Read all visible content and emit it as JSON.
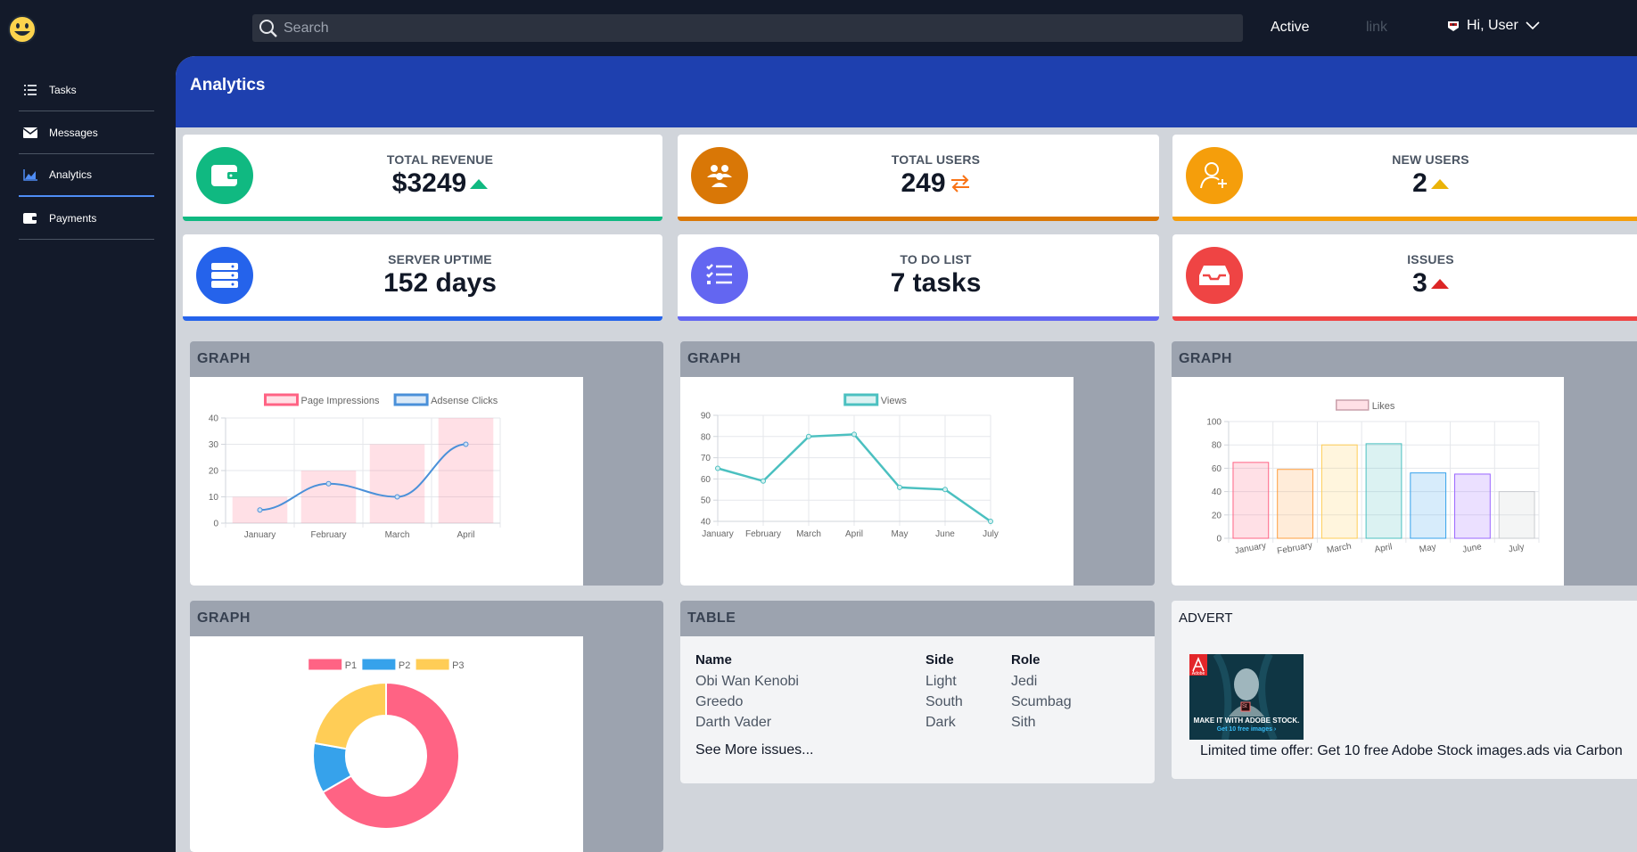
{
  "sidebar": {
    "items": [
      {
        "label": "Tasks",
        "icon": "tasks-list-icon"
      },
      {
        "label": "Messages",
        "icon": "envelope-icon"
      },
      {
        "label": "Analytics",
        "icon": "area-chart-icon"
      },
      {
        "label": "Payments",
        "icon": "wallet-icon"
      }
    ]
  },
  "topbar": {
    "search_placeholder": "Search",
    "active_label": "Active",
    "link_label": "link",
    "user_label": "Hi, User"
  },
  "header": {
    "title": "Analytics"
  },
  "stats": [
    {
      "label": "TOTAL REVENUE",
      "value": "$3249",
      "icon": "wallet-icon",
      "color": "#10b981",
      "trend": "up"
    },
    {
      "label": "TOTAL USERS",
      "value": "249",
      "icon": "users-icon",
      "color": "#d97706",
      "trend": "exchange"
    },
    {
      "label": "NEW USERS",
      "value": "2",
      "icon": "user-plus-icon",
      "color": "#f59e0b",
      "trend": "up"
    },
    {
      "label": "SERVER UPTIME",
      "value": "152 days",
      "icon": "server-icon",
      "color": "#2563eb",
      "trend": "none"
    },
    {
      "label": "TO DO LIST",
      "value": "7 tasks",
      "icon": "tasks-icon",
      "color": "#6366f1",
      "trend": "none"
    },
    {
      "label": "ISSUES",
      "value": "3",
      "icon": "inbox-icon",
      "color": "#ef4444",
      "trend": "up"
    }
  ],
  "panels": {
    "graph1_title": "GRAPH",
    "graph2_title": "GRAPH",
    "graph3_title": "GRAPH",
    "graph4_title": "GRAPH",
    "table_title": "TABLE",
    "advert_title": "ADVERT"
  },
  "table": {
    "headers": [
      "Name",
      "Side",
      "Role"
    ],
    "rows": [
      [
        "Obi Wan Kenobi",
        "Light",
        "Jedi"
      ],
      [
        "Greedo",
        "South",
        "Scumbag"
      ],
      [
        "Darth Vader",
        "Dark",
        "Sith"
      ]
    ],
    "more_label": "See More issues..."
  },
  "advert": {
    "text": "Limited time offer: Get 10 free Adobe Stock images.ads via Carbon",
    "image_caption": "MAKE IT WITH ADOBE STOCK.",
    "image_sub": "Get 10 free images ›",
    "brand": "Adobe",
    "badge": "St"
  },
  "chart_data": [
    {
      "type": "bar",
      "categories": [
        "January",
        "February",
        "March",
        "April"
      ],
      "series": [
        {
          "name": "Page Impressions",
          "type": "bar",
          "values": [
            10,
            20,
            30,
            40
          ],
          "color": "#ff6384"
        },
        {
          "name": "Adsense Clicks",
          "type": "line",
          "values": [
            5,
            15,
            10,
            30
          ],
          "color": "#4a90d9"
        }
      ],
      "ylim": [
        0,
        40
      ],
      "yticks": [
        0,
        10,
        20,
        30,
        40
      ],
      "legend": "top"
    },
    {
      "type": "line",
      "categories": [
        "January",
        "February",
        "March",
        "April",
        "May",
        "June",
        "July"
      ],
      "series": [
        {
          "name": "Views",
          "values": [
            65,
            59,
            80,
            81,
            56,
            55,
            40
          ],
          "color": "#4bc0c0"
        }
      ],
      "ylim": [
        40,
        90
      ],
      "yticks": [
        40,
        50,
        60,
        70,
        80,
        90
      ],
      "legend": "top"
    },
    {
      "type": "bar",
      "categories": [
        "January",
        "February",
        "March",
        "April",
        "May",
        "June",
        "July"
      ],
      "series": [
        {
          "name": "Likes",
          "values": [
            65,
            59,
            80,
            81,
            56,
            55,
            40
          ],
          "colors": [
            "#ff6384",
            "#ff9f40",
            "#ffcd56",
            "#4bc0c0",
            "#36a2eb",
            "#9966ff",
            "#c9cbcf"
          ]
        }
      ],
      "ylim": [
        0,
        100
      ],
      "yticks": [
        0,
        20,
        40,
        60,
        80,
        100
      ],
      "legend": "top"
    },
    {
      "type": "pie",
      "categories": [
        "P1",
        "P2",
        "P3"
      ],
      "values": [
        300,
        50,
        100
      ],
      "colors": [
        "#ff6384",
        "#36a2eb",
        "#ffcd56"
      ],
      "legend": "top"
    }
  ]
}
